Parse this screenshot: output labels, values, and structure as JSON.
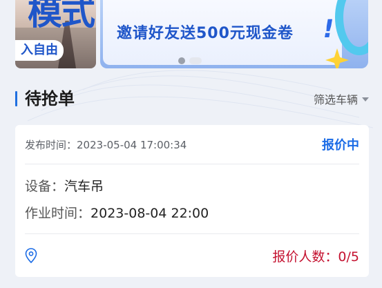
{
  "banner": {
    "side_char": "模式",
    "side_tag": "入自由",
    "headline": "邀请好友送500元现金卷",
    "exclaim": "!",
    "dots": [
      {
        "active": true
      },
      {
        "active": false
      }
    ]
  },
  "section": {
    "title": "待抢单",
    "filter_label": "筛选车辆"
  },
  "order": {
    "publish_label": "发布时间：",
    "publish_time": "2023-05-04 17:00:34",
    "status": "报价中",
    "equipment_label": "设备：",
    "equipment_value": "汽车吊",
    "work_time_label": "作业时间：",
    "work_time_value": "2023-08-04 22:00",
    "bid_label": "报价人数：",
    "bid_value": "0/5"
  },
  "colors": {
    "accent": "#1a6be6",
    "bid": "#c4112f",
    "background": "#eef1f7"
  }
}
